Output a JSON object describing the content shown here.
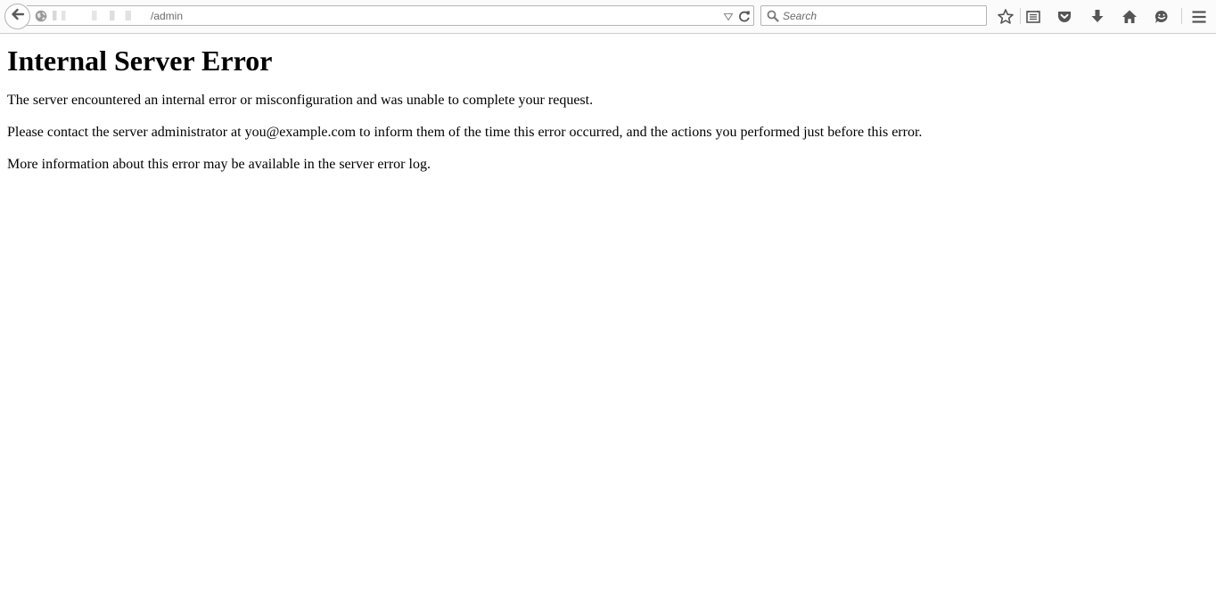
{
  "browser": {
    "url_suffix": "/admin",
    "search_placeholder": "Search"
  },
  "page": {
    "heading": "Internal Server Error",
    "paragraph_1": "The server encountered an internal error or misconfiguration and was unable to complete your request.",
    "paragraph_2": "Please contact the server administrator at you@example.com to inform them of the time this error occurred, and the actions you performed just before this error.",
    "paragraph_3": "More information about this error may be available in the server error log."
  },
  "icons": [
    "back-arrow-icon",
    "globe-icon",
    "dropmarker-icon",
    "reload-icon",
    "search-icon",
    "bookmark-star-icon",
    "reading-list-icon",
    "pocket-icon",
    "download-icon",
    "home-icon",
    "chat-icon",
    "menu-icon"
  ]
}
